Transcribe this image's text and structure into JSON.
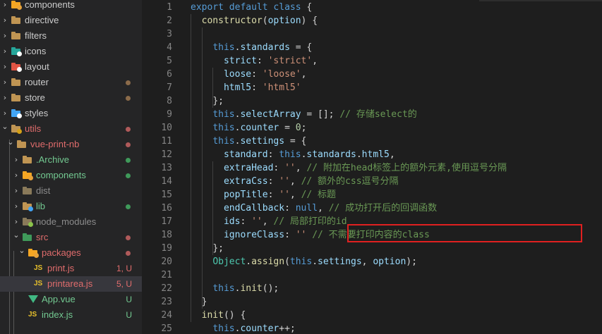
{
  "explorer": {
    "items": [
      {
        "label": "components",
        "kind": "folder",
        "color": "#f5a623",
        "badge": "#e8a33a",
        "labelColor": "#cccccc",
        "depth": 0,
        "open": false,
        "status": "",
        "statusColor": ""
      },
      {
        "label": "directive",
        "kind": "folder",
        "color": "#c09553",
        "badge": "",
        "labelColor": "#cccccc",
        "depth": 0,
        "open": false,
        "status": "",
        "statusColor": ""
      },
      {
        "label": "filters",
        "kind": "folder",
        "color": "#c09553",
        "badge": "",
        "labelColor": "#cccccc",
        "depth": 0,
        "open": false,
        "status": "",
        "statusColor": ""
      },
      {
        "label": "icons",
        "kind": "folder",
        "color": "#26a69a",
        "badge": "#ffffff",
        "labelColor": "#cccccc",
        "depth": 0,
        "open": false,
        "status": "",
        "statusColor": ""
      },
      {
        "label": "layout",
        "kind": "folder",
        "color": "#e25444",
        "badge": "#ffffff",
        "labelColor": "#cccccc",
        "depth": 0,
        "open": false,
        "status": "",
        "statusColor": ""
      },
      {
        "label": "router",
        "kind": "folder",
        "color": "#c09553",
        "badge": "",
        "labelColor": "#cccccc",
        "depth": 0,
        "open": false,
        "status": "dot",
        "statusColor": "#8b6b4a"
      },
      {
        "label": "store",
        "kind": "folder",
        "color": "#c09553",
        "badge": "",
        "labelColor": "#cccccc",
        "depth": 0,
        "open": false,
        "status": "dot",
        "statusColor": "#8b6b4a"
      },
      {
        "label": "styles",
        "kind": "folder",
        "color": "#42a5f5",
        "badge": "#ffffff",
        "labelColor": "#cccccc",
        "depth": 0,
        "open": false,
        "status": "",
        "statusColor": ""
      },
      {
        "label": "utils",
        "kind": "folder",
        "color": "#c09553",
        "badge": "#d4a017",
        "labelColor": "#e06c6c",
        "depth": 0,
        "open": true,
        "status": "dot",
        "statusColor": "#b05a5a"
      },
      {
        "label": "vue-print-nb",
        "kind": "folder",
        "color": "#c09553",
        "badge": "",
        "labelColor": "#e06c6c",
        "depth": 1,
        "open": true,
        "status": "dot",
        "statusColor": "#b05a5a"
      },
      {
        "label": ".Archive",
        "kind": "folder",
        "color": "#c09553",
        "badge": "",
        "labelColor": "#73c991",
        "depth": 2,
        "open": false,
        "status": "dot",
        "statusColor": "#3f9a5a"
      },
      {
        "label": "components",
        "kind": "folder",
        "color": "#f5a623",
        "badge": "#e8a33a",
        "labelColor": "#73c991",
        "depth": 2,
        "open": false,
        "status": "dot",
        "statusColor": "#3f9a5a"
      },
      {
        "label": "dist",
        "kind": "folder",
        "color": "#8a7a5a",
        "badge": "",
        "labelColor": "#8c8c8c",
        "depth": 2,
        "open": false,
        "status": "",
        "statusColor": ""
      },
      {
        "label": "lib",
        "kind": "folder",
        "color": "#c09553",
        "badge": "#42a5f5",
        "labelColor": "#73c991",
        "depth": 2,
        "open": false,
        "status": "dot",
        "statusColor": "#3f9a5a"
      },
      {
        "label": "node_modules",
        "kind": "folder",
        "color": "#8a7a5a",
        "badge": "#8bc34a",
        "labelColor": "#8c8c8c",
        "depth": 2,
        "open": false,
        "status": "",
        "statusColor": ""
      },
      {
        "label": "src",
        "kind": "folder",
        "color": "#3f9a5a",
        "badge": "",
        "labelColor": "#e06c6c",
        "depth": 2,
        "open": true,
        "status": "dot",
        "statusColor": "#b05a5a"
      },
      {
        "label": "packages",
        "kind": "folder",
        "color": "#f5a623",
        "badge": "#e8a33a",
        "labelColor": "#e06c6c",
        "depth": 3,
        "open": true,
        "status": "dot",
        "statusColor": "#b05a5a"
      },
      {
        "label": "print.js",
        "kind": "js",
        "color": "#e8c12c",
        "badge": "",
        "labelColor": "#e06c6c",
        "depth": 4,
        "open": false,
        "status": "1, U",
        "statusColor": "#e06c6c"
      },
      {
        "label": "printarea.js",
        "kind": "js",
        "color": "#e8c12c",
        "badge": "",
        "labelColor": "#e06c6c",
        "depth": 4,
        "open": false,
        "status": "5, U",
        "statusColor": "#e06c6c",
        "selected": true
      },
      {
        "label": "App.vue",
        "kind": "vue",
        "color": "#41b883",
        "badge": "",
        "labelColor": "#73c991",
        "depth": 3,
        "open": false,
        "status": "U",
        "statusColor": "#73c991"
      },
      {
        "label": "index.js",
        "kind": "js",
        "color": "#e8c12c",
        "badge": "",
        "labelColor": "#73c991",
        "depth": 3,
        "open": false,
        "status": "U",
        "statusColor": "#73c991"
      }
    ]
  },
  "editor": {
    "lines": [
      {
        "n": "1",
        "indent": 0,
        "tokens": [
          [
            "kw",
            "export"
          ],
          [
            "p",
            " "
          ],
          [
            "kw",
            "default"
          ],
          [
            "p",
            " "
          ],
          [
            "kw",
            "class"
          ],
          [
            "p",
            " {"
          ]
        ]
      },
      {
        "n": "2",
        "indent": 1,
        "tokens": [
          [
            "fn",
            "constructor"
          ],
          [
            "p",
            "("
          ],
          [
            "var",
            "option"
          ],
          [
            "p",
            ") {"
          ]
        ]
      },
      {
        "n": "3",
        "indent": 0,
        "tokens": []
      },
      {
        "n": "4",
        "indent": 2,
        "tokens": [
          [
            "kw",
            "this"
          ],
          [
            "p",
            "."
          ],
          [
            "var",
            "standards"
          ],
          [
            "p",
            " = {"
          ]
        ]
      },
      {
        "n": "5",
        "indent": 3,
        "tokens": [
          [
            "var",
            "strict"
          ],
          [
            "p",
            ": "
          ],
          [
            "str",
            "'strict'"
          ],
          [
            "p",
            ","
          ]
        ]
      },
      {
        "n": "6",
        "indent": 3,
        "tokens": [
          [
            "var",
            "loose"
          ],
          [
            "p",
            ": "
          ],
          [
            "str",
            "'loose'"
          ],
          [
            "p",
            ","
          ]
        ]
      },
      {
        "n": "7",
        "indent": 3,
        "tokens": [
          [
            "var",
            "html5"
          ],
          [
            "p",
            ": "
          ],
          [
            "str",
            "'html5'"
          ]
        ]
      },
      {
        "n": "8",
        "indent": 2,
        "tokens": [
          [
            "p",
            "};"
          ]
        ]
      },
      {
        "n": "9",
        "indent": 2,
        "tokens": [
          [
            "kw",
            "this"
          ],
          [
            "p",
            "."
          ],
          [
            "var",
            "selectArray"
          ],
          [
            "p",
            " = []; "
          ],
          [
            "cm",
            "// 存储select的"
          ]
        ]
      },
      {
        "n": "10",
        "indent": 2,
        "tokens": [
          [
            "kw",
            "this"
          ],
          [
            "p",
            "."
          ],
          [
            "var",
            "counter"
          ],
          [
            "p",
            " = "
          ],
          [
            "num",
            "0"
          ],
          [
            "p",
            ";"
          ]
        ]
      },
      {
        "n": "11",
        "indent": 2,
        "tokens": [
          [
            "kw",
            "this"
          ],
          [
            "p",
            "."
          ],
          [
            "var",
            "settings"
          ],
          [
            "p",
            " = {"
          ]
        ]
      },
      {
        "n": "12",
        "indent": 3,
        "tokens": [
          [
            "var",
            "standard"
          ],
          [
            "p",
            ": "
          ],
          [
            "kw",
            "this"
          ],
          [
            "p",
            "."
          ],
          [
            "var",
            "standards"
          ],
          [
            "p",
            "."
          ],
          [
            "var",
            "html5"
          ],
          [
            "p",
            ","
          ]
        ]
      },
      {
        "n": "13",
        "indent": 3,
        "tokens": [
          [
            "var",
            "extraHead"
          ],
          [
            "p",
            ": "
          ],
          [
            "str",
            "''"
          ],
          [
            "p",
            ", "
          ],
          [
            "cm",
            "// 附加在head标签上的额外元素,使用逗号分隔"
          ]
        ]
      },
      {
        "n": "14",
        "indent": 3,
        "tokens": [
          [
            "var",
            "extraCss"
          ],
          [
            "p",
            ": "
          ],
          [
            "str",
            "''"
          ],
          [
            "p",
            ", "
          ],
          [
            "cm",
            "// 额外的css逗号分隔"
          ]
        ]
      },
      {
        "n": "15",
        "indent": 3,
        "tokens": [
          [
            "var",
            "popTitle"
          ],
          [
            "p",
            ": "
          ],
          [
            "str",
            "''"
          ],
          [
            "p",
            ", "
          ],
          [
            "cm",
            "// 标题"
          ]
        ]
      },
      {
        "n": "16",
        "indent": 3,
        "tokens": [
          [
            "var",
            "endCallback"
          ],
          [
            "p",
            ": "
          ],
          [
            "kw",
            "null"
          ],
          [
            "p",
            ", "
          ],
          [
            "cm",
            "// 成功打开后的回调函数"
          ]
        ]
      },
      {
        "n": "17",
        "indent": 3,
        "tokens": [
          [
            "var",
            "ids"
          ],
          [
            "p",
            ": "
          ],
          [
            "str",
            "''"
          ],
          [
            "p",
            ", "
          ],
          [
            "cm",
            "// 局部打印的id"
          ]
        ]
      },
      {
        "n": "18",
        "indent": 3,
        "tokens": [
          [
            "var",
            "ignoreClass"
          ],
          [
            "p",
            ": "
          ],
          [
            "str",
            "''"
          ],
          [
            "p",
            " "
          ],
          [
            "cm",
            "// 不需要打印内容的class"
          ]
        ]
      },
      {
        "n": "19",
        "indent": 2,
        "tokens": [
          [
            "p",
            "};"
          ]
        ]
      },
      {
        "n": "20",
        "indent": 2,
        "tokens": [
          [
            "fn2",
            "Object"
          ],
          [
            "p",
            "."
          ],
          [
            "fn",
            "assign"
          ],
          [
            "p",
            "("
          ],
          [
            "kw",
            "this"
          ],
          [
            "p",
            "."
          ],
          [
            "var",
            "settings"
          ],
          [
            "p",
            ", "
          ],
          [
            "var",
            "option"
          ],
          [
            "p",
            ");"
          ]
        ]
      },
      {
        "n": "21",
        "indent": 0,
        "tokens": []
      },
      {
        "n": "22",
        "indent": 2,
        "tokens": [
          [
            "kw",
            "this"
          ],
          [
            "p",
            "."
          ],
          [
            "fn",
            "init"
          ],
          [
            "p",
            "();"
          ]
        ]
      },
      {
        "n": "23",
        "indent": 1,
        "tokens": [
          [
            "p",
            "}"
          ]
        ]
      },
      {
        "n": "24",
        "indent": 1,
        "tokens": [
          [
            "fn",
            "init"
          ],
          [
            "p",
            "() {"
          ]
        ]
      },
      {
        "n": "25",
        "indent": 2,
        "tokens": [
          [
            "kw",
            "this"
          ],
          [
            "p",
            "."
          ],
          [
            "var",
            "counter"
          ],
          [
            "p",
            "++;"
          ]
        ]
      }
    ],
    "colors": {
      "kw": "#569cd6",
      "fn": "#dcdcaa",
      "fn2": "#4ec9b0",
      "var": "#9cdcfe",
      "str": "#ce9178",
      "cm": "#6a9955",
      "num": "#b5cea8",
      "p": "#d4d4d4"
    }
  }
}
